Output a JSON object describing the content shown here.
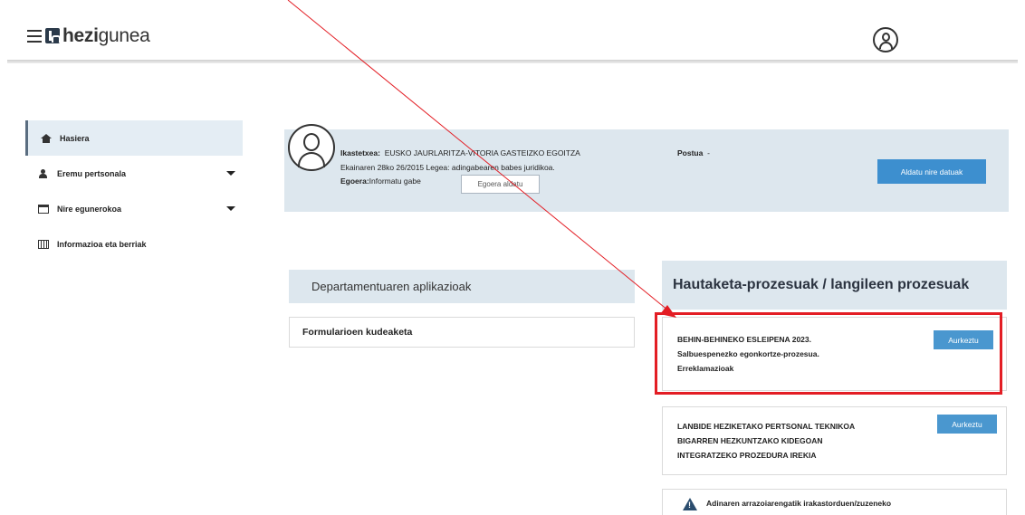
{
  "header": {
    "logo_prefix": "hezi",
    "logo_suffix": "gunea",
    "menu_icon": "hamburger-icon",
    "logo_icon": "hezigunea-logo-icon",
    "user_icon": "user-avatar-icon"
  },
  "sidebar": {
    "items": [
      {
        "label": "Hasiera",
        "icon": "home-icon",
        "active": true
      },
      {
        "label": "Eremu pertsonala",
        "icon": "person-icon",
        "has_dropdown": true
      },
      {
        "label": "Nire egunerokoa",
        "icon": "calendar-icon",
        "has_dropdown": true
      },
      {
        "label": "Informazioa eta berriak",
        "icon": "news-icon"
      }
    ]
  },
  "profile": {
    "center_label": "Ikastetxea:",
    "center_value": "EUSKO JAURLARITZA-VITORIA GASTEIZKO EGOITZA",
    "post_label": "Postua",
    "post_value": "-",
    "law_text": "Ekainaren 28ko 26/2015 Legea: adingabearen babes juridikoa.",
    "state_label": "Egoera:",
    "state_value": "Informatu gabe",
    "state_button": "Egoera aldatu",
    "update_button": "Aldatu nire datuak"
  },
  "apps": {
    "title": "Departamentuaren aplikazioak",
    "items": [
      "Formularioen kudeaketa"
    ]
  },
  "processes": {
    "title": "Hautaketa-prozesuak / langileen prozesuak",
    "items": [
      {
        "line1": "BEHIN-BEHINEKO ESLEIPENA 2023.",
        "line2": "Salbuespenezko egonkortze-prozesua.",
        "line3": "Erreklamazioak",
        "button": "Aurkeztu"
      },
      {
        "line1": "LANBIDE HEZIKETAKO PERTSONAL TEKNIKOA",
        "line2": "BIGARREN HEZKUNTZAKO KIDEGOAN",
        "line3": "INTEGRATZEKO PROZEDURA IREKIA",
        "button": "Aurkeztu"
      }
    ],
    "warning": {
      "icon": "warning-icon",
      "text": "Adinaren arrazoiarengatik irakastorduen/zuzeneko"
    }
  },
  "annotation": {
    "arrow_color": "#e31d24",
    "highlight_color": "#e31d24"
  }
}
